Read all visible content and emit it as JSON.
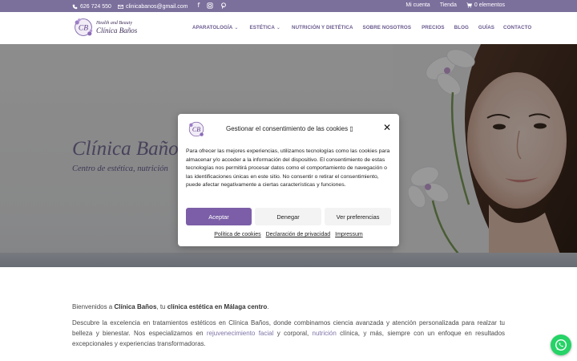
{
  "topbar": {
    "phone": "626 724 550",
    "email": "clinicabanos@gmail.com",
    "social_icons": [
      "facebook-icon",
      "instagram-icon",
      "pinterest-icon"
    ],
    "my_account": "Mi cuenta",
    "shop": "Tienda",
    "cart": "0 elementos"
  },
  "logo": {
    "line1": "Health and Beauty",
    "line2": "Clínica Baños"
  },
  "nav": {
    "items": [
      {
        "label": "APARATOLOGÍA",
        "dropdown": true
      },
      {
        "label": "ESTÉTICA",
        "dropdown": true
      },
      {
        "label": "NUTRICIÓN Y DIETÉTICA",
        "dropdown": false
      },
      {
        "label": "SOBRE NOSOTROS",
        "dropdown": false
      },
      {
        "label": "PRECIOS",
        "dropdown": false
      },
      {
        "label": "BLOG",
        "dropdown": false
      },
      {
        "label": "GUÍAS",
        "dropdown": false
      },
      {
        "label": "CONTACTO",
        "dropdown": false
      }
    ]
  },
  "hero": {
    "title": "Clínica Baños",
    "subtitle": "Centro de estética, nutrición"
  },
  "content": {
    "p1_pre": "Bienvenidos a ",
    "p1_b1": "Clínica Baños",
    "p1_mid": ", tu ",
    "p1_b2": "clínica estética en Málaga centro",
    "p1_end": ".",
    "p2_a": "Descubre la excelencia en tratamientos estéticos en Clínica Baños, donde combinamos ciencia avanzada y atención personalizada para realzar tu belleza y bienestar. Nos especializamos en ",
    "p2_link1": "rejuvenecimiento facial",
    "p2_b": " y corporal, ",
    "p2_link2": "nutrición",
    "p2_c": " clínica, y más, siempre con un enfoque en resultados excepcionales y experiencias transformadoras."
  },
  "consent": {
    "title": "Gestionar el consentimiento de las cookies ▯",
    "body": "Para ofrecer las mejores experiencias, utilizamos tecnologías como las cookies para almacenar y/o acceder a la información del dispositivo. El consentimiento de estas tecnologías nos permitirá procesar datos como el comportamiento de navegación o las identificaciones únicas en este sitio. No consentir o retirar el consentimiento, puede afectar negativamente a ciertas características y funciones.",
    "accept": "Aceptar",
    "deny": "Denegar",
    "preferences": "Ver preferencias",
    "links": [
      "Política de cookies",
      "Declaración de privacidad",
      "Impressum"
    ]
  },
  "colors": {
    "topbar": "#7b6f9c",
    "accent": "#7b5ea7",
    "nav_text": "#6a5a8e",
    "whatsapp": "#25d366"
  }
}
